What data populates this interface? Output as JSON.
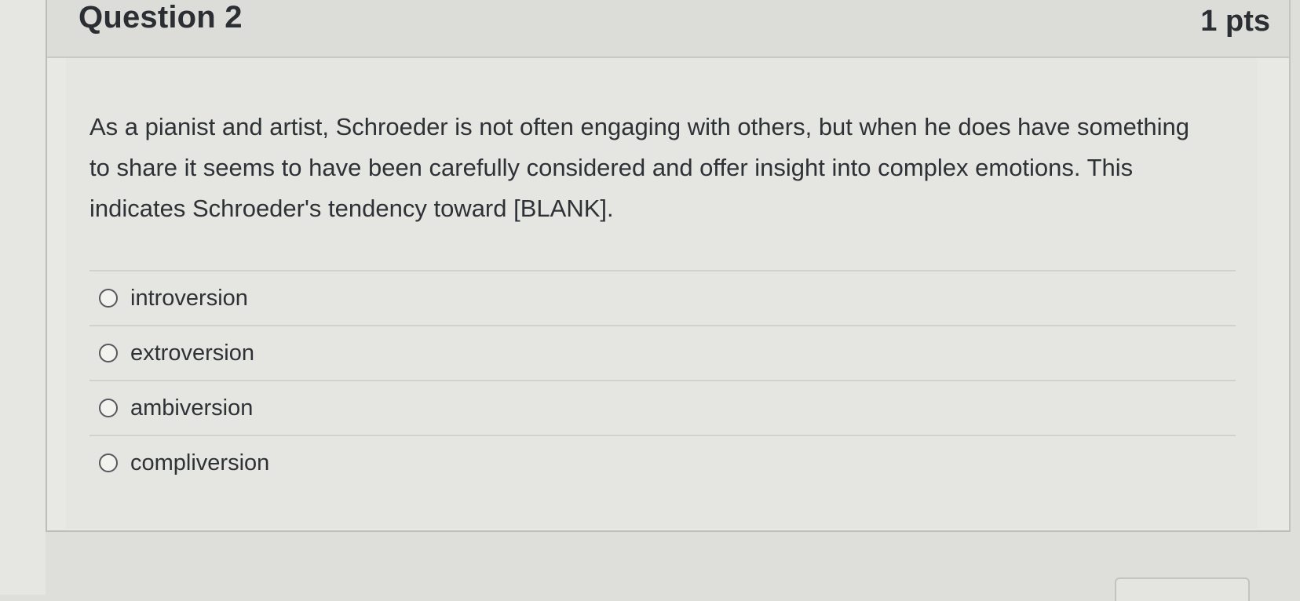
{
  "question": {
    "title": "Question 2",
    "points": "1 pts",
    "text": "As a pianist and artist, Schroeder is not often engaging with others, but when he does have something to share it seems to have been carefully considered and offer insight into complex emotions.  This indicates Schroeder's tendency toward [BLANK].",
    "answers": [
      {
        "label": "introversion"
      },
      {
        "label": "extroversion"
      },
      {
        "label": "ambiversion"
      },
      {
        "label": "compliversion"
      }
    ]
  }
}
